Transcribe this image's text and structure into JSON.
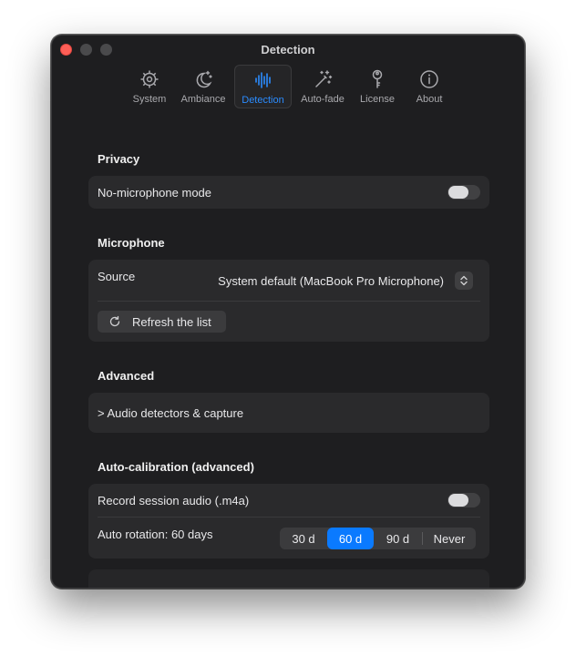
{
  "window": {
    "title": "Detection"
  },
  "toolbar": {
    "tabs": [
      {
        "label": "System",
        "icon": "gear-icon"
      },
      {
        "label": "Ambiance",
        "icon": "moon-stars-icon"
      },
      {
        "label": "Detection",
        "icon": "waveform-icon",
        "active": true
      },
      {
        "label": "Auto-fade",
        "icon": "magic-wand-icon"
      },
      {
        "label": "License",
        "icon": "key-icon"
      },
      {
        "label": "About",
        "icon": "info-icon"
      }
    ]
  },
  "colors": {
    "accent": "#0a7aff",
    "close": "#fe5f57",
    "background": "#1e1e20",
    "card": "#2a2a2c"
  },
  "privacy": {
    "title": "Privacy",
    "no_mic_label": "No-microphone mode",
    "no_mic_on": false
  },
  "microphone": {
    "title": "Microphone",
    "source_label": "Source",
    "source_value": "System default (MacBook Pro Microphone)",
    "refresh_label": "Refresh the list"
  },
  "advanced": {
    "title": "Advanced",
    "disclosure_label": "> Audio detectors & capture"
  },
  "autocal": {
    "title": "Auto-calibration (advanced)",
    "record_label": "Record session audio (.m4a)",
    "record_on": false,
    "rotation_label": "Auto rotation: 60 days",
    "options": [
      "30 d",
      "60 d",
      "90 d",
      "Never"
    ],
    "selected": "60 d"
  }
}
